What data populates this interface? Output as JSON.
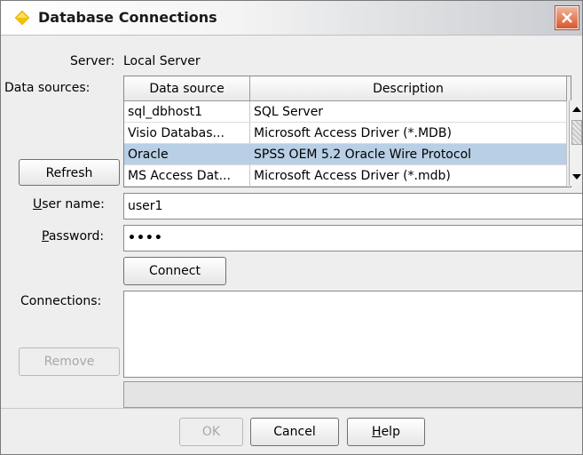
{
  "window": {
    "title": "Database Connections",
    "icon": "diamond-icon",
    "close_icon": "close-icon"
  },
  "server": {
    "label": "Server:",
    "value": "Local Server"
  },
  "data_sources": {
    "label": "Data sources:",
    "columns": [
      "Data source",
      "Description"
    ],
    "rows": [
      {
        "name": "sql_dbhost1",
        "description": "SQL Server"
      },
      {
        "name": "Visio Databas...",
        "description": "Microsoft Access Driver (*.MDB)"
      },
      {
        "name": "Oracle",
        "description": "SPSS OEM 5.2 Oracle Wire Protocol"
      },
      {
        "name": "MS Access Dat...",
        "description": "Microsoft Access Driver (*.mdb)"
      }
    ],
    "selected_index": 2,
    "refresh_label": "Refresh"
  },
  "credentials": {
    "username_label_mnemonic": "U",
    "username_label_rest": "ser name:",
    "username_value": "user1",
    "password_label_mnemonic": "P",
    "password_label_rest": "assword:",
    "password_value": "••••"
  },
  "connect_label": "Connect",
  "connections": {
    "label": "Connections:",
    "remove_label": "Remove"
  },
  "footer": {
    "ok_label": "OK",
    "cancel_label": "Cancel",
    "help_mnemonic": "H",
    "help_rest": "elp"
  },
  "colors": {
    "selection": "#b8cfe5",
    "title_icon": "#f2c200",
    "close_button": "#d9562c"
  }
}
